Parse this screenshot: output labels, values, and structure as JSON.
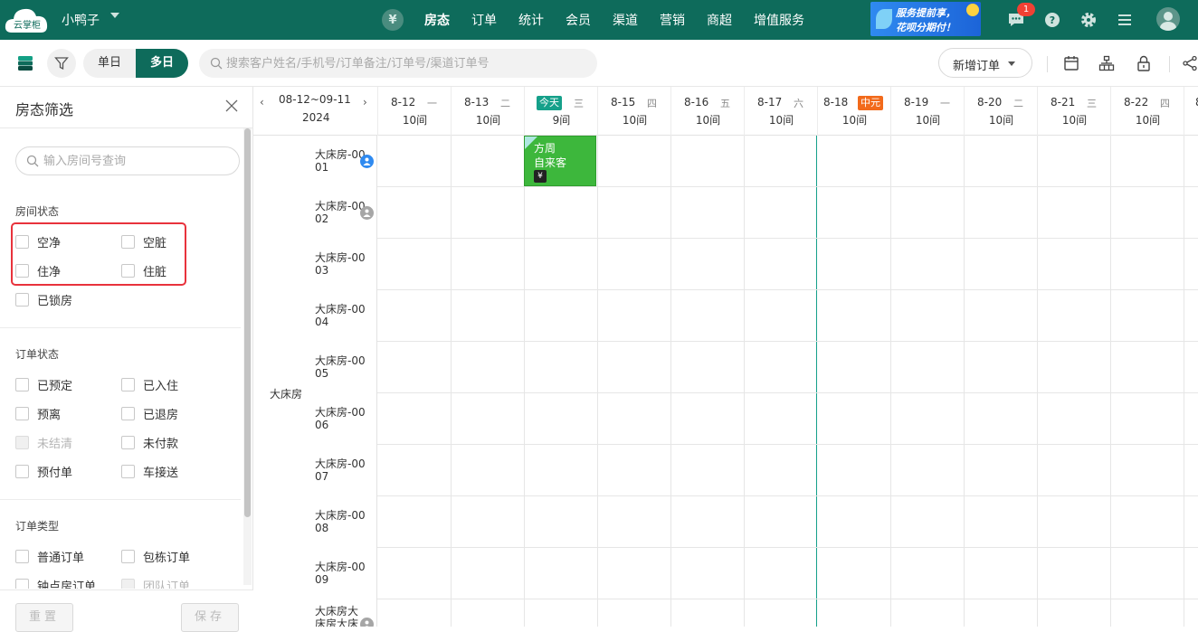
{
  "header": {
    "logo_text": "云掌柜",
    "hotel_name": "小鸭子",
    "nav": [
      "房态",
      "订单",
      "统计",
      "会员",
      "渠道",
      "营销",
      "商超",
      "增值服务"
    ],
    "active_nav": "房态",
    "banner_line1": "服务提前享，",
    "banner_line2": "花呗分期付！",
    "notification_count": "1",
    "icons": [
      "yen-icon",
      "message-icon",
      "help-icon",
      "gear-icon",
      "menu-icon",
      "avatar-icon"
    ]
  },
  "toolbar": {
    "view_single": "单日",
    "view_multi": "多日",
    "active_view": "多日",
    "search_placeholder": "搜索客户姓名/手机号/订单备注/订单号/渠道订单号",
    "new_order_label": "新增订单"
  },
  "filter_panel": {
    "title": "房态筛选",
    "room_search_placeholder": "输入房间号查询",
    "sections": [
      {
        "title": "房间状态",
        "options": [
          "空净",
          "空脏",
          "住净",
          "住脏",
          "已锁房"
        ]
      },
      {
        "title": "订单状态",
        "options": [
          "已预定",
          "已入住",
          "预离",
          "已退房",
          "未结清",
          "未付款",
          "预付单",
          "车接送"
        ],
        "disabled": [
          "未结清"
        ]
      },
      {
        "title": "订单类型",
        "options": [
          "普通订单",
          "包栋订单",
          "钟点房订单",
          "团队订单"
        ],
        "disabled": [
          "团队订单"
        ]
      }
    ],
    "reset_label": "重置",
    "save_label": "保存"
  },
  "calendar": {
    "range": "08-12~09-11",
    "year": "2024",
    "days": [
      {
        "date": "8-12",
        "weekday": "一",
        "count": "10间",
        "tag": ""
      },
      {
        "date": "8-13",
        "weekday": "二",
        "count": "10间",
        "tag": ""
      },
      {
        "date": "",
        "weekday": "三",
        "count": "9间",
        "tag": "今天"
      },
      {
        "date": "8-15",
        "weekday": "四",
        "count": "10间",
        "tag": ""
      },
      {
        "date": "8-16",
        "weekday": "五",
        "count": "10间",
        "tag": ""
      },
      {
        "date": "8-17",
        "weekday": "六",
        "count": "10间",
        "tag": ""
      },
      {
        "date": "8-18",
        "weekday": "",
        "count": "10间",
        "tag": "中元"
      },
      {
        "date": "8-19",
        "weekday": "一",
        "count": "10间",
        "tag": ""
      },
      {
        "date": "8-20",
        "weekday": "二",
        "count": "10间",
        "tag": ""
      },
      {
        "date": "8-21",
        "weekday": "三",
        "count": "10间",
        "tag": ""
      },
      {
        "date": "8-22",
        "weekday": "四",
        "count": "10间",
        "tag": ""
      }
    ],
    "category": "大床房",
    "rooms": [
      "大床房-0001",
      "大床房-0002",
      "大床房-0003",
      "大床房-0004",
      "大床房-0005",
      "大床房-0006",
      "大床房-0007",
      "大床房-0008",
      "大床房-0009",
      "大床房大床房大床"
    ],
    "booking": {
      "name": "方周",
      "source": "自来客",
      "pay_badge": "¥"
    },
    "colors": {
      "primary": "#0e6b5b",
      "today": "#15a08a",
      "holiday": "#f26a1b",
      "booking": "#3db73c"
    }
  }
}
